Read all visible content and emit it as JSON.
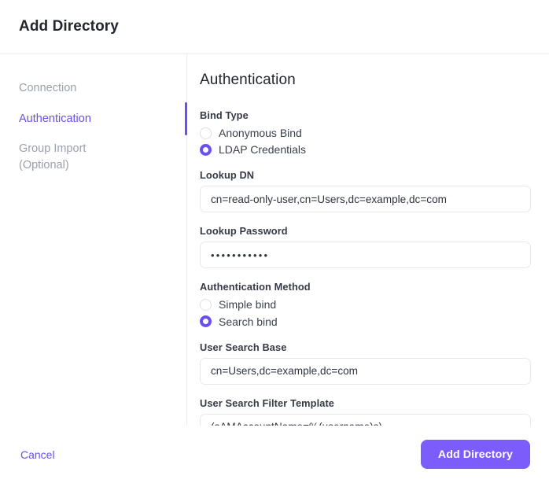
{
  "header": {
    "title": "Add Directory"
  },
  "sidebar": {
    "items": [
      {
        "label": "Connection",
        "active": false
      },
      {
        "label": "Authentication",
        "active": true
      },
      {
        "label": "Group Import\n(Optional)",
        "active": false
      }
    ]
  },
  "content": {
    "section_title": "Authentication",
    "bind_type": {
      "label": "Bind Type",
      "options": [
        {
          "label": "Anonymous Bind",
          "selected": false
        },
        {
          "label": "LDAP Credentials",
          "selected": true
        }
      ]
    },
    "lookup_dn": {
      "label": "Lookup DN",
      "value": "cn=read-only-user,cn=Users,dc=example,dc=com",
      "placeholder": ""
    },
    "lookup_password": {
      "label": "Lookup Password",
      "value": "•••••••••••",
      "placeholder": ""
    },
    "authentication_method": {
      "label": "Authentication Method",
      "options": [
        {
          "label": "Simple bind",
          "selected": false
        },
        {
          "label": "Search bind",
          "selected": true
        }
      ]
    },
    "user_search_base": {
      "label": "User Search Base",
      "value": "cn=Users,dc=example,dc=com",
      "placeholder": ""
    },
    "user_search_filter_template": {
      "label": "User Search Filter Template",
      "value": "(sAMAccountName=%(username)s)",
      "placeholder": ""
    }
  },
  "footer": {
    "cancel_label": "Cancel",
    "submit_label": "Add Directory"
  },
  "colors": {
    "accent": "#6c4ff0",
    "primary_button": "#7c5cfa",
    "muted_text": "#9aa0ab",
    "border": "#e6e8ec"
  }
}
